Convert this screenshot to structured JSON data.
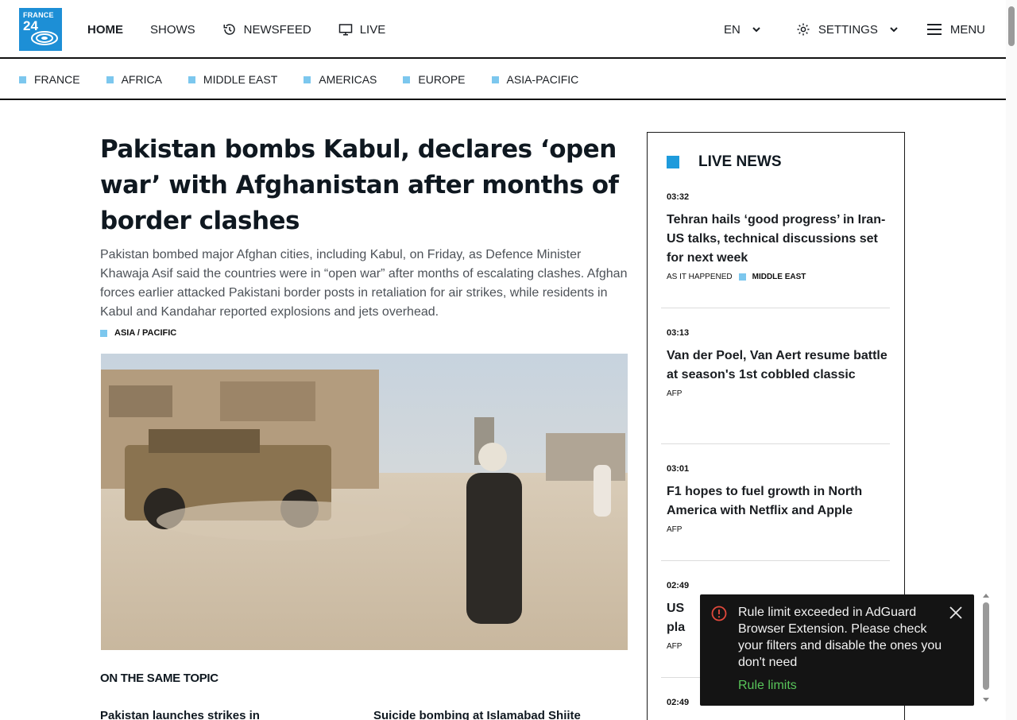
{
  "logo": {
    "line1": "FRANCE",
    "line2": "24"
  },
  "nav": {
    "items": [
      {
        "label": "HOME",
        "active": true
      },
      {
        "label": "SHOWS"
      },
      {
        "label": "NEWSFEED",
        "icon": "history-icon"
      },
      {
        "label": "LIVE",
        "icon": "tv-icon"
      }
    ],
    "language": "EN",
    "settings": "SETTINGS",
    "menu": "MENU"
  },
  "regions": [
    "FRANCE",
    "AFRICA",
    "MIDDLE EAST",
    "AMERICAS",
    "EUROPE",
    "ASIA-PACIFIC"
  ],
  "article": {
    "headline": "Pakistan bombs Kabul, declares ‘open war’ with Afghanistan after months of border clashes",
    "lede": "Pakistan bombed major Afghan cities, including Kabul, on Friday, as Defence Minister Khawaja Asif said the countries were in “open war” after months of escalating clashes. Afghan forces earlier attacked Pakistani border posts in retaliation for air strikes, while residents in Kabul and Kandahar reported explosions and jets overhead.",
    "tag": "ASIA / PACIFIC"
  },
  "same_topic": {
    "heading": "ON THE SAME TOPIC",
    "items": [
      "Pakistan launches strikes in",
      "Suicide bombing at Islamabad Shiite"
    ]
  },
  "live_news": {
    "heading": "LIVE NEWS",
    "items": [
      {
        "time": "03:32",
        "title": "Tehran hails ‘good progress’ in Iran-US talks, technical discussions set for next week",
        "source": "AS IT HAPPENED",
        "category": "MIDDLE EAST"
      },
      {
        "time": "03:13",
        "title": "Van der Poel, Van Aert resume battle at season's 1st cobbled classic",
        "source": "AFP"
      },
      {
        "time": "03:01",
        "title": "F1 hopes to fuel growth in North America with Netflix and Apple",
        "source": "AFP"
      },
      {
        "time": "02:49",
        "title": "US pla media",
        "source": "AFP"
      },
      {
        "time": "02:49"
      }
    ]
  },
  "toast": {
    "message": "Rule limit exceeded in AdGuard Browser Extension. Please check your filters and disable the ones you don't need",
    "link": "Rule limits"
  },
  "colors": {
    "accent_blue": "#1e9bdc",
    "region_square": "#7cc7ee",
    "toast_link": "#58c55a"
  }
}
